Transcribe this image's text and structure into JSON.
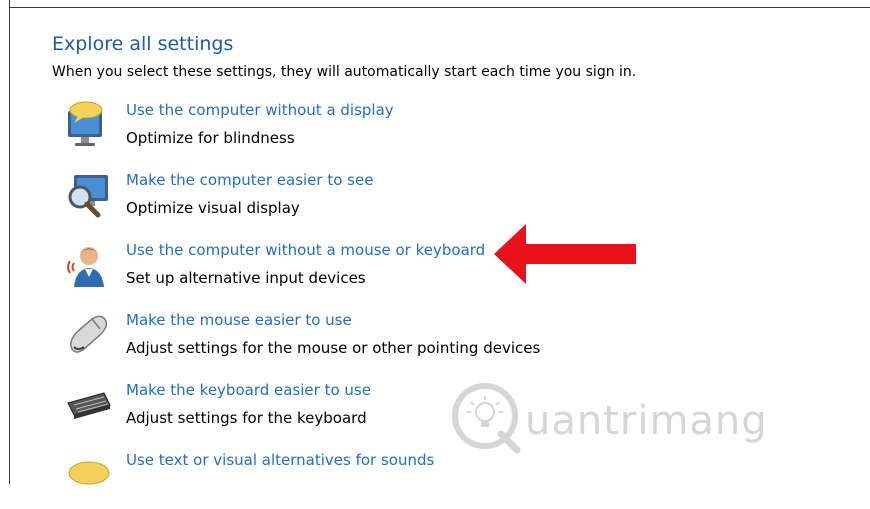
{
  "section": {
    "title": "Explore all settings",
    "description": "When you select these settings, they will automatically start each time you sign in."
  },
  "items": [
    {
      "icon": "monitor-speech-bubble-icon",
      "link": "Use the computer without a display",
      "desc": "Optimize for blindness"
    },
    {
      "icon": "magnifier-monitor-icon",
      "link": "Make the computer easier to see",
      "desc": "Optimize visual display"
    },
    {
      "icon": "person-speaking-icon",
      "link": "Use the computer without a mouse or keyboard",
      "desc": "Set up alternative input devices"
    },
    {
      "icon": "mouse-icon",
      "link": "Make the mouse easier to use",
      "desc": "Adjust settings for the mouse or other pointing devices"
    },
    {
      "icon": "keyboard-icon",
      "link": "Make the keyboard easier to use",
      "desc": "Adjust settings for the keyboard"
    },
    {
      "icon": "speech-bubble-icon",
      "link": "Use text or visual alternatives for sounds",
      "desc": ""
    }
  ],
  "annotation": {
    "icon": "red-arrow-icon",
    "color": "#e8121b"
  },
  "watermark": {
    "text": "uantrimang",
    "icon": "quantrimang-logo-icon"
  },
  "colors": {
    "link": "#1f6fc6",
    "title": "#1e5aa8"
  }
}
